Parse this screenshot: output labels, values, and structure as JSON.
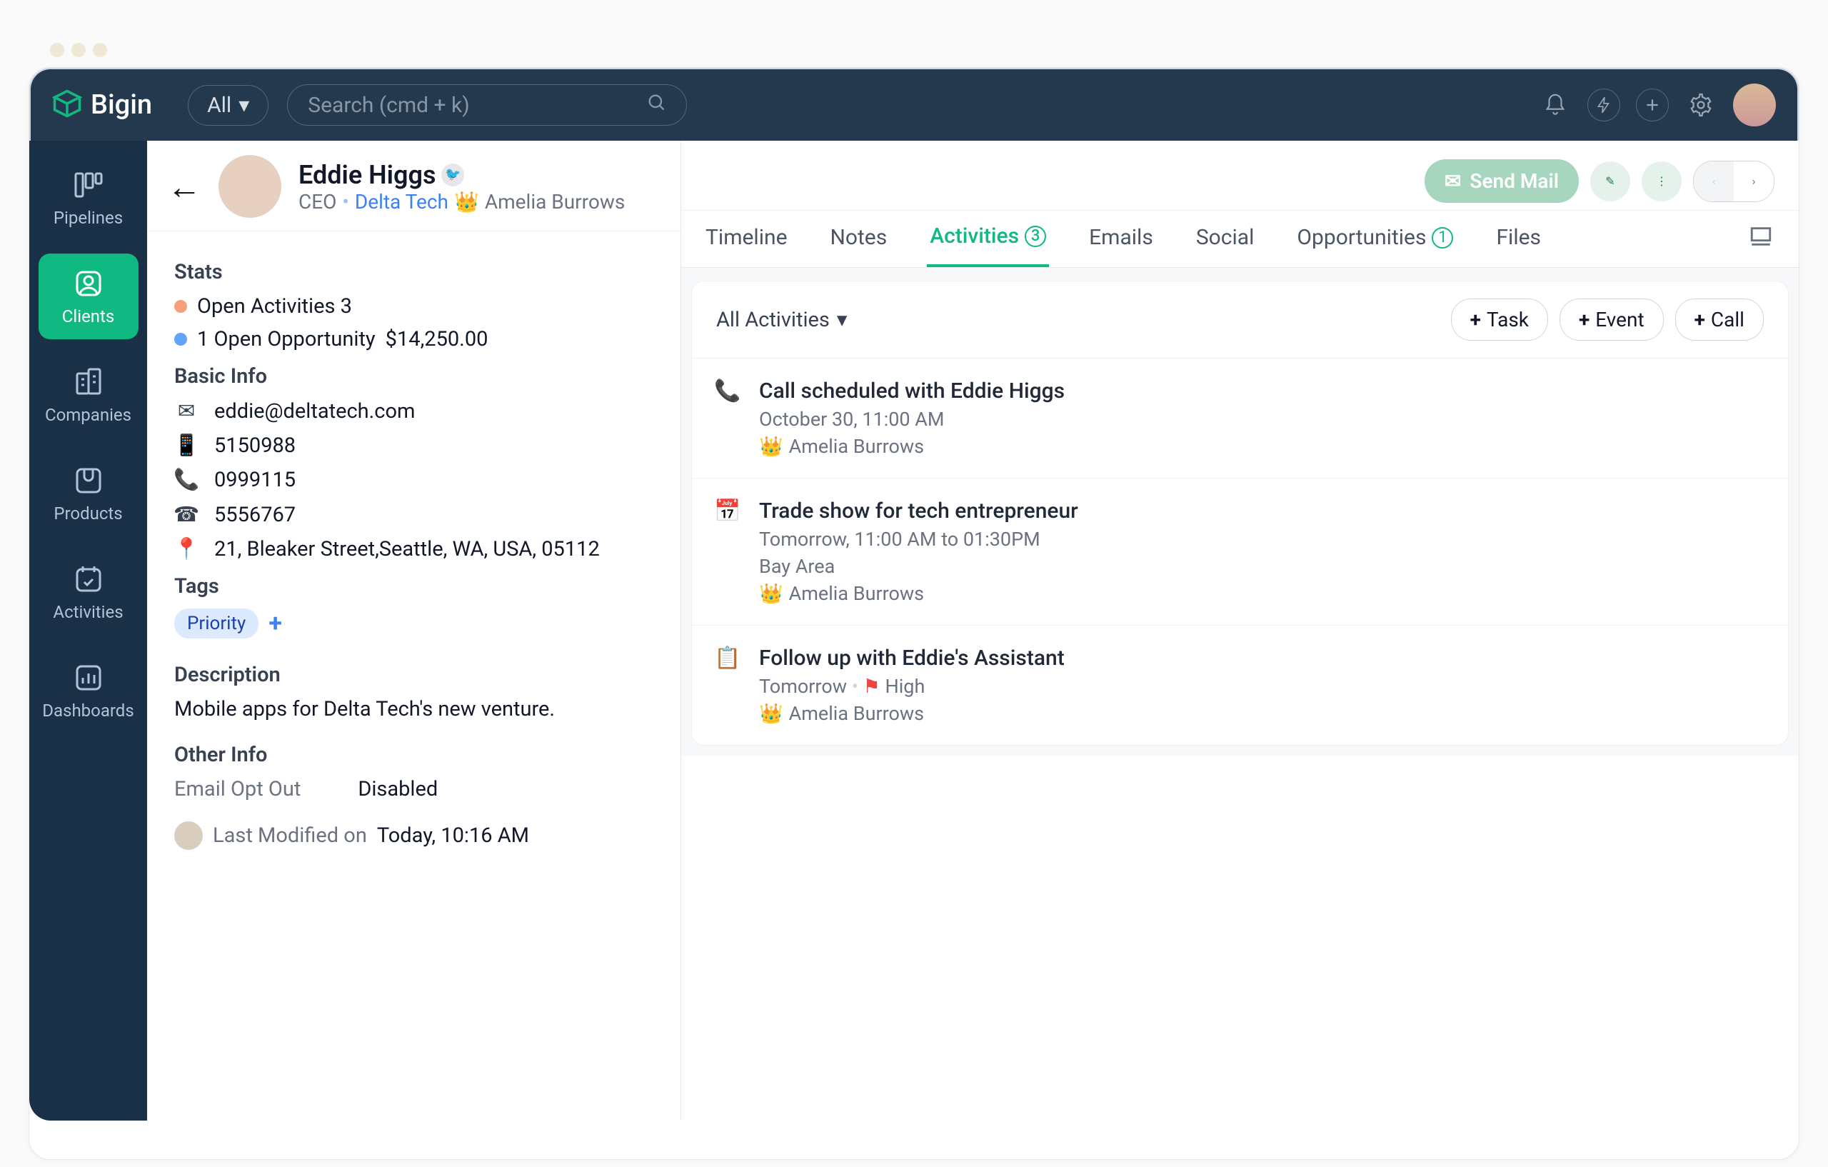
{
  "app": {
    "name": "Bigin"
  },
  "topbar": {
    "filter": "All",
    "search_placeholder": "Search (cmd + k)"
  },
  "sidebar": {
    "items": [
      {
        "label": "Pipelines"
      },
      {
        "label": "Clients"
      },
      {
        "label": "Companies"
      },
      {
        "label": "Products"
      },
      {
        "label": "Activities"
      },
      {
        "label": "Dashboards"
      }
    ]
  },
  "contact": {
    "name": "Eddie Higgs",
    "title": "CEO",
    "company": "Delta Tech",
    "owner": "Amelia Burrows"
  },
  "actions": {
    "sendmail": "Send Mail"
  },
  "stats": {
    "heading": "Stats",
    "open_activities_label": "Open Activities 3",
    "open_opportunity_label": "1 Open Opportunity",
    "open_opportunity_value": "$14,250.00"
  },
  "basic": {
    "heading": "Basic Info",
    "email": "eddie@deltatech.com",
    "mobile": "5150988",
    "phone1": "0999115",
    "phone2": "5556767",
    "address": "21, Bleaker Street,Seattle, WA, USA, 05112"
  },
  "tags": {
    "heading": "Tags",
    "tag": "Priority"
  },
  "description": {
    "heading": "Description",
    "text": "Mobile apps for Delta Tech's new venture."
  },
  "other": {
    "heading": "Other Info",
    "optout_label": "Email Opt Out",
    "optout_value": "Disabled"
  },
  "lastmod": {
    "label": "Last Modified on",
    "value": "Today, 10:16 AM"
  },
  "tabs": {
    "timeline": "Timeline",
    "notes": "Notes",
    "activities": "Activities",
    "activities_count": "3",
    "emails": "Emails",
    "social": "Social",
    "opportunities": "Opportunities",
    "opportunities_count": "1",
    "files": "Files"
  },
  "actpanel": {
    "filter": "All Activities",
    "btn_task": "Task",
    "btn_event": "Event",
    "btn_call": "Call",
    "items": [
      {
        "icon": "call",
        "title": "Call scheduled with Eddie Higgs",
        "when": "October 30, 11:00 AM",
        "owner": "Amelia Burrows"
      },
      {
        "icon": "event",
        "title": "Trade show for tech entrepreneur",
        "when": "Tomorrow, 11:00 AM to 01:30PM",
        "where": "Bay Area",
        "owner": "Amelia Burrows"
      },
      {
        "icon": "task",
        "title": "Follow up with Eddie's Assistant",
        "when": "Tomorrow",
        "priority": "High",
        "owner": "Amelia Burrows"
      }
    ]
  }
}
